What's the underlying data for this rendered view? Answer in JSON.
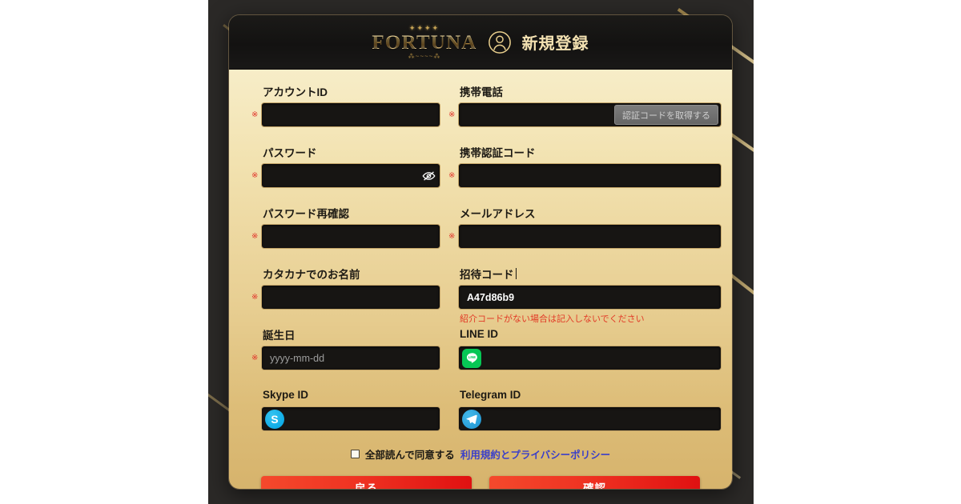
{
  "header": {
    "brand_crown": "✦✦✦✦",
    "brand": "FORTUNA",
    "brand_flourish": "⁂~~~~⁂",
    "user_icon": "user-circle-icon",
    "title": "新規登録"
  },
  "colors": {
    "card_top": "#f7edc8",
    "card_bottom": "#d6b36c",
    "gold_border": "#c3a468",
    "input_bg": "#171513",
    "required_mark": "#e0342a",
    "hint_red": "#e23b27",
    "link_blue": "#3a3fc9",
    "button_red_start": "#f4492c",
    "button_red_end": "#e01111",
    "backdrop": "#2b2927"
  },
  "required_mark": "※",
  "form": {
    "account_id": {
      "label": "アカウントID",
      "value": "",
      "placeholder": ""
    },
    "phone": {
      "label": "携帯電話",
      "value": "",
      "placeholder": "",
      "button": "認証コードを取得する"
    },
    "password": {
      "label": "パスワード",
      "value": "",
      "placeholder": "",
      "icon": "eye-slash-icon"
    },
    "phone_code": {
      "label": "携帯認証コード",
      "value": "",
      "placeholder": ""
    },
    "password_confirm": {
      "label": "パスワード再確認",
      "value": "",
      "placeholder": ""
    },
    "email": {
      "label": "メールアドレス",
      "value": "",
      "placeholder": ""
    },
    "katakana_name": {
      "label": "カタカナでのお名前",
      "value": "",
      "placeholder": ""
    },
    "invite_code": {
      "label": "招待コード",
      "value": "A47d86b9",
      "placeholder": "",
      "hint": "紹介コードがない場合は記入しないでください"
    },
    "birthday": {
      "label": "誕生日",
      "value": "",
      "placeholder": "yyyy-mm-dd"
    },
    "line_id": {
      "label": "LINE ID",
      "value": "",
      "placeholder": "",
      "icon": "line-icon"
    },
    "skype_id": {
      "label": "Skype ID",
      "value": "",
      "placeholder": "",
      "icon": "skype-icon"
    },
    "telegram_id": {
      "label": "Telegram ID",
      "value": "",
      "placeholder": "",
      "icon": "telegram-icon"
    }
  },
  "agreement": {
    "checked": false,
    "text": "全部読んで同意する",
    "link": "利用規約とプライバシーポリシー"
  },
  "actions": {
    "back": "戻る",
    "confirm": "確認"
  }
}
